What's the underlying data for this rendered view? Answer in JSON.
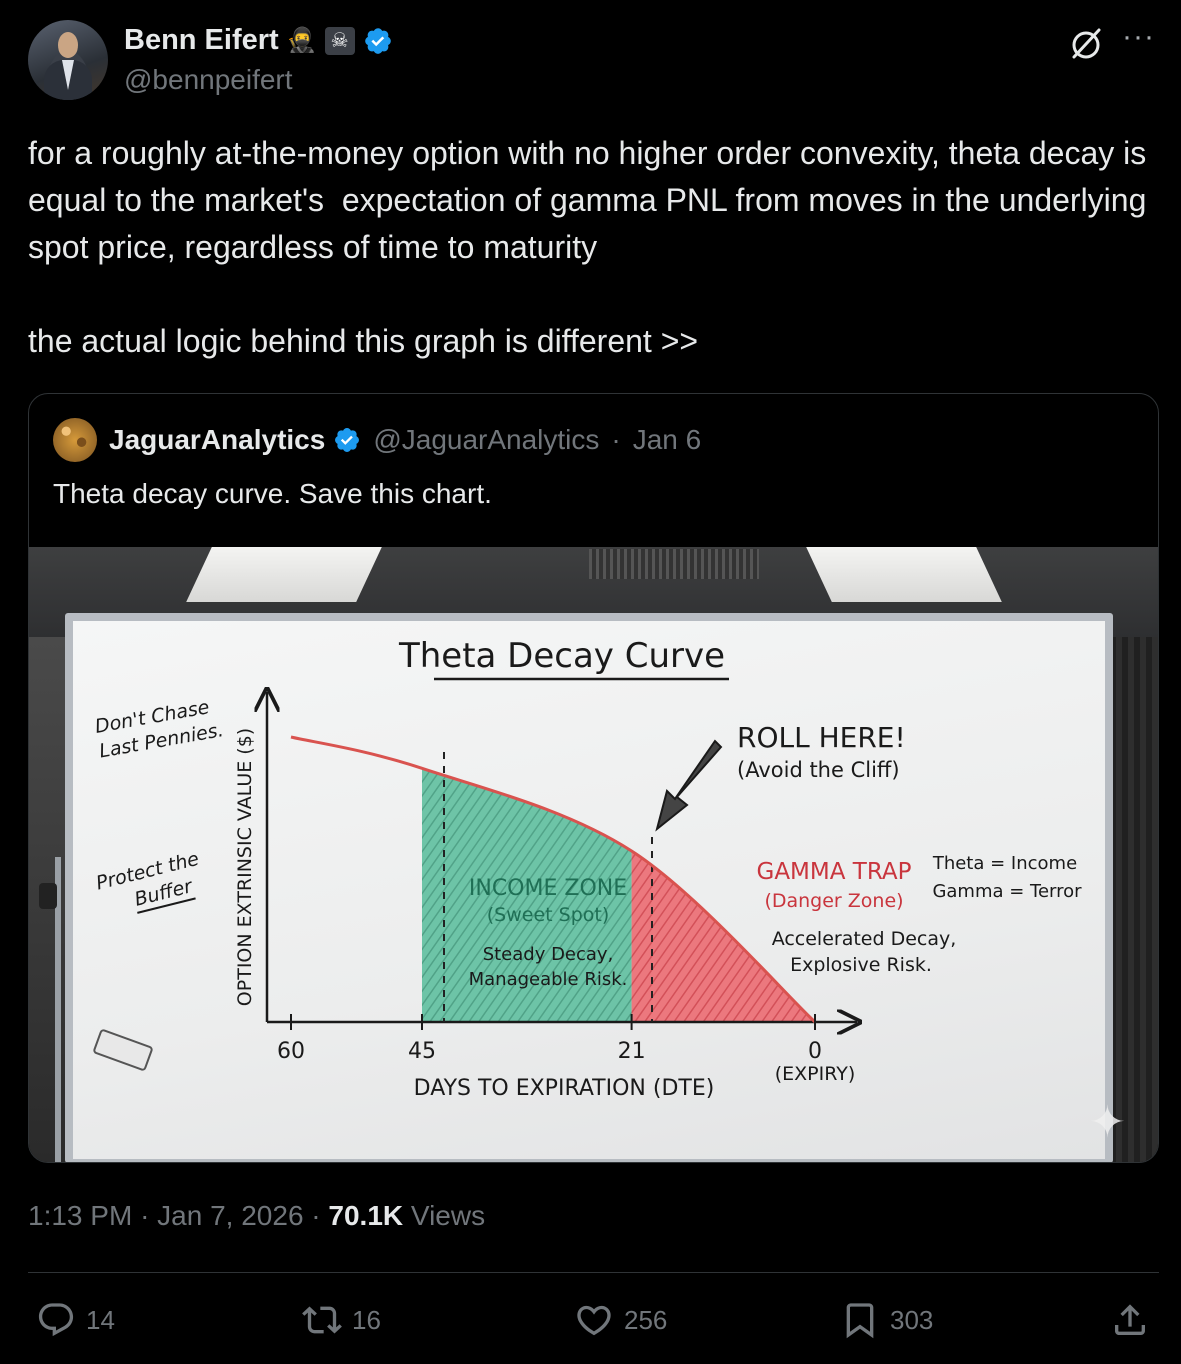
{
  "author": {
    "display_name": "Benn Eifert",
    "handle": "@bennpeifert",
    "badges": [
      "ninja-emoji",
      "skull-crossbones-emoji",
      "verified-badge"
    ],
    "avatar": "profile-photo"
  },
  "tweet": {
    "text": "for a roughly at-the-money option with no higher order convexity, theta decay is equal to the market's  expectation of gamma PNL from moves in the underlying spot price, regardless of time to maturity\n\nthe actual logic behind this graph is different >>"
  },
  "quoted_tweet": {
    "display_name": "JaguarAnalytics",
    "handle": "@JaguarAnalytics",
    "separator": "·",
    "date": "Jan 6",
    "text": "Theta decay curve. Save this chart."
  },
  "whiteboard": {
    "title": "Theta Decay Curve",
    "note_top_left": [
      "Don't Chase",
      "Last Pennies."
    ],
    "note_mid_left": [
      "Protect the",
      "Buffer"
    ],
    "roll_label": "ROLL HERE!",
    "roll_sub": "(Avoid the Cliff)",
    "income_zone": "INCOME ZONE",
    "income_sub": "(Sweet Spot)",
    "income_desc": [
      "Steady Decay,",
      "Manageable Risk."
    ],
    "gamma_trap": "GAMMA TRAP",
    "gamma_sub": "(Danger Zone)",
    "gamma_desc": [
      "Accelerated Decay,",
      "Explosive Risk."
    ],
    "legend": [
      "Theta = Income",
      "Gamma = Terror"
    ],
    "colors": {
      "curve": "#d9534f",
      "income_fill": "#4fb393",
      "danger_fill": "#e0525a",
      "ink": "#1a1a1a"
    }
  },
  "chart_data": {
    "type": "line",
    "title": "Theta Decay Curve",
    "xlabel": "DAYS TO EXPIRATION (DTE)",
    "ylabel": "OPTION EXTRINSIC VALUE ($)",
    "x_ticks": [
      "60",
      "45",
      "21",
      "0"
    ],
    "x_tick_extra": "(EXPIRY)",
    "series": [
      {
        "x": [
          60,
          45,
          21,
          0
        ],
        "y": [
          1.0,
          0.89,
          0.6,
          0.0
        ]
      }
    ],
    "shaded_regions": [
      {
        "label": "INCOME ZONE",
        "from": 45,
        "to": 21
      },
      {
        "label": "GAMMA TRAP",
        "from": 21,
        "to": 0
      }
    ]
  },
  "meta": {
    "time": "1:13 PM",
    "separator": "·",
    "date": "Jan 7, 2026",
    "views_count": "70.1K",
    "views_label": "Views"
  },
  "actions": {
    "replies": "14",
    "reposts": "16",
    "likes": "256",
    "bookmarks": "303"
  }
}
